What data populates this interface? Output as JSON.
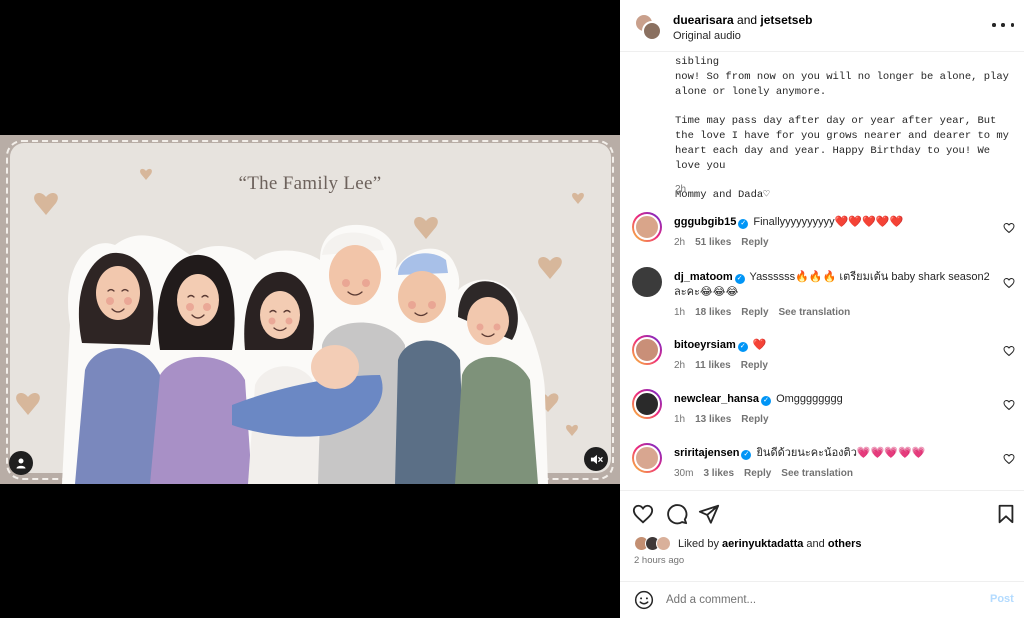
{
  "media": {
    "title": "“The Family Lee”",
    "user_tag_icon": "user-icon",
    "mute_icon": "speaker-muted-icon"
  },
  "header": {
    "user1": "duearisara",
    "joiner": "and",
    "user2": "jetsetseb",
    "audio": "Original audio",
    "more_icon": "more-horizontal-icon"
  },
  "caption": {
    "cut_line": "have baby just for you, cause you are having a sibling",
    "line_partial": "now! So from now on you will no longer be alone, play alone or lonely anymore.",
    "paragraph2": "Time may pass day after day or year after year, But the love I have for you grows nearer and dearer to my heart each day and year. Happy Birthday to you! We love you",
    "signoff": "Mommy and Dada♡",
    "time": "2h"
  },
  "comments": [
    {
      "user": "gggubgib15",
      "verified": true,
      "text": "Finallyyyyyyyyyy",
      "emoji": "❤️❤️❤️❤️❤️",
      "time": "2h",
      "likes": "51 likes",
      "reply": "Reply",
      "translate": "",
      "avatar_color": "#d9a58a",
      "ring": true
    },
    {
      "user": "dj_matoom",
      "verified": true,
      "text": "Yassssss",
      "emoji": "🔥🔥🔥",
      "text2": "เตรียมเต้น baby shark season2 ละคะ",
      "emoji2": "😂😂😂",
      "time": "1h",
      "likes": "18 likes",
      "reply": "Reply",
      "translate": "See translation",
      "avatar_color": "#3b3b3b",
      "ring": false
    },
    {
      "user": "bitoeyrsiam",
      "verified": true,
      "text": "",
      "emoji": "❤️",
      "time": "2h",
      "likes": "11 likes",
      "reply": "Reply",
      "translate": "",
      "avatar_color": "#c98f78",
      "ring": true
    },
    {
      "user": "newclear_hansa",
      "verified": true,
      "text": "Omgggggggg",
      "emoji": "",
      "time": "1h",
      "likes": "13 likes",
      "reply": "Reply",
      "translate": "",
      "avatar_color": "#2a2a2a",
      "ring": true
    },
    {
      "user": "sriritajensen",
      "verified": true,
      "text": "ยินดีด้วยนะคะน้องติว",
      "emoji": "💗💗💗💗💗",
      "time": "30m",
      "likes": "3 likes",
      "reply": "Reply",
      "translate": "See translation",
      "avatar_color": "#d8a690",
      "ring": true
    }
  ],
  "actions": {
    "like_icon": "heart-icon",
    "comment_icon": "comment-icon",
    "share_icon": "send-icon",
    "save_icon": "bookmark-icon",
    "liked_prefix": "Liked by",
    "liked_user": "aerinyuktadatta",
    "liked_and": "and",
    "liked_others": "others",
    "post_time": "2 hours ago"
  },
  "composer": {
    "emoji_icon": "emoji-icon",
    "placeholder": "Add a comment...",
    "post_label": "Post"
  },
  "colors": {
    "verified": "#0095f6",
    "heart": "#ed1e3a",
    "pink_heart": "#f45b9f",
    "post_disabled": "#b3dbff",
    "card_bg": "#e7e3de",
    "frame_bg": "#b8ada6"
  }
}
